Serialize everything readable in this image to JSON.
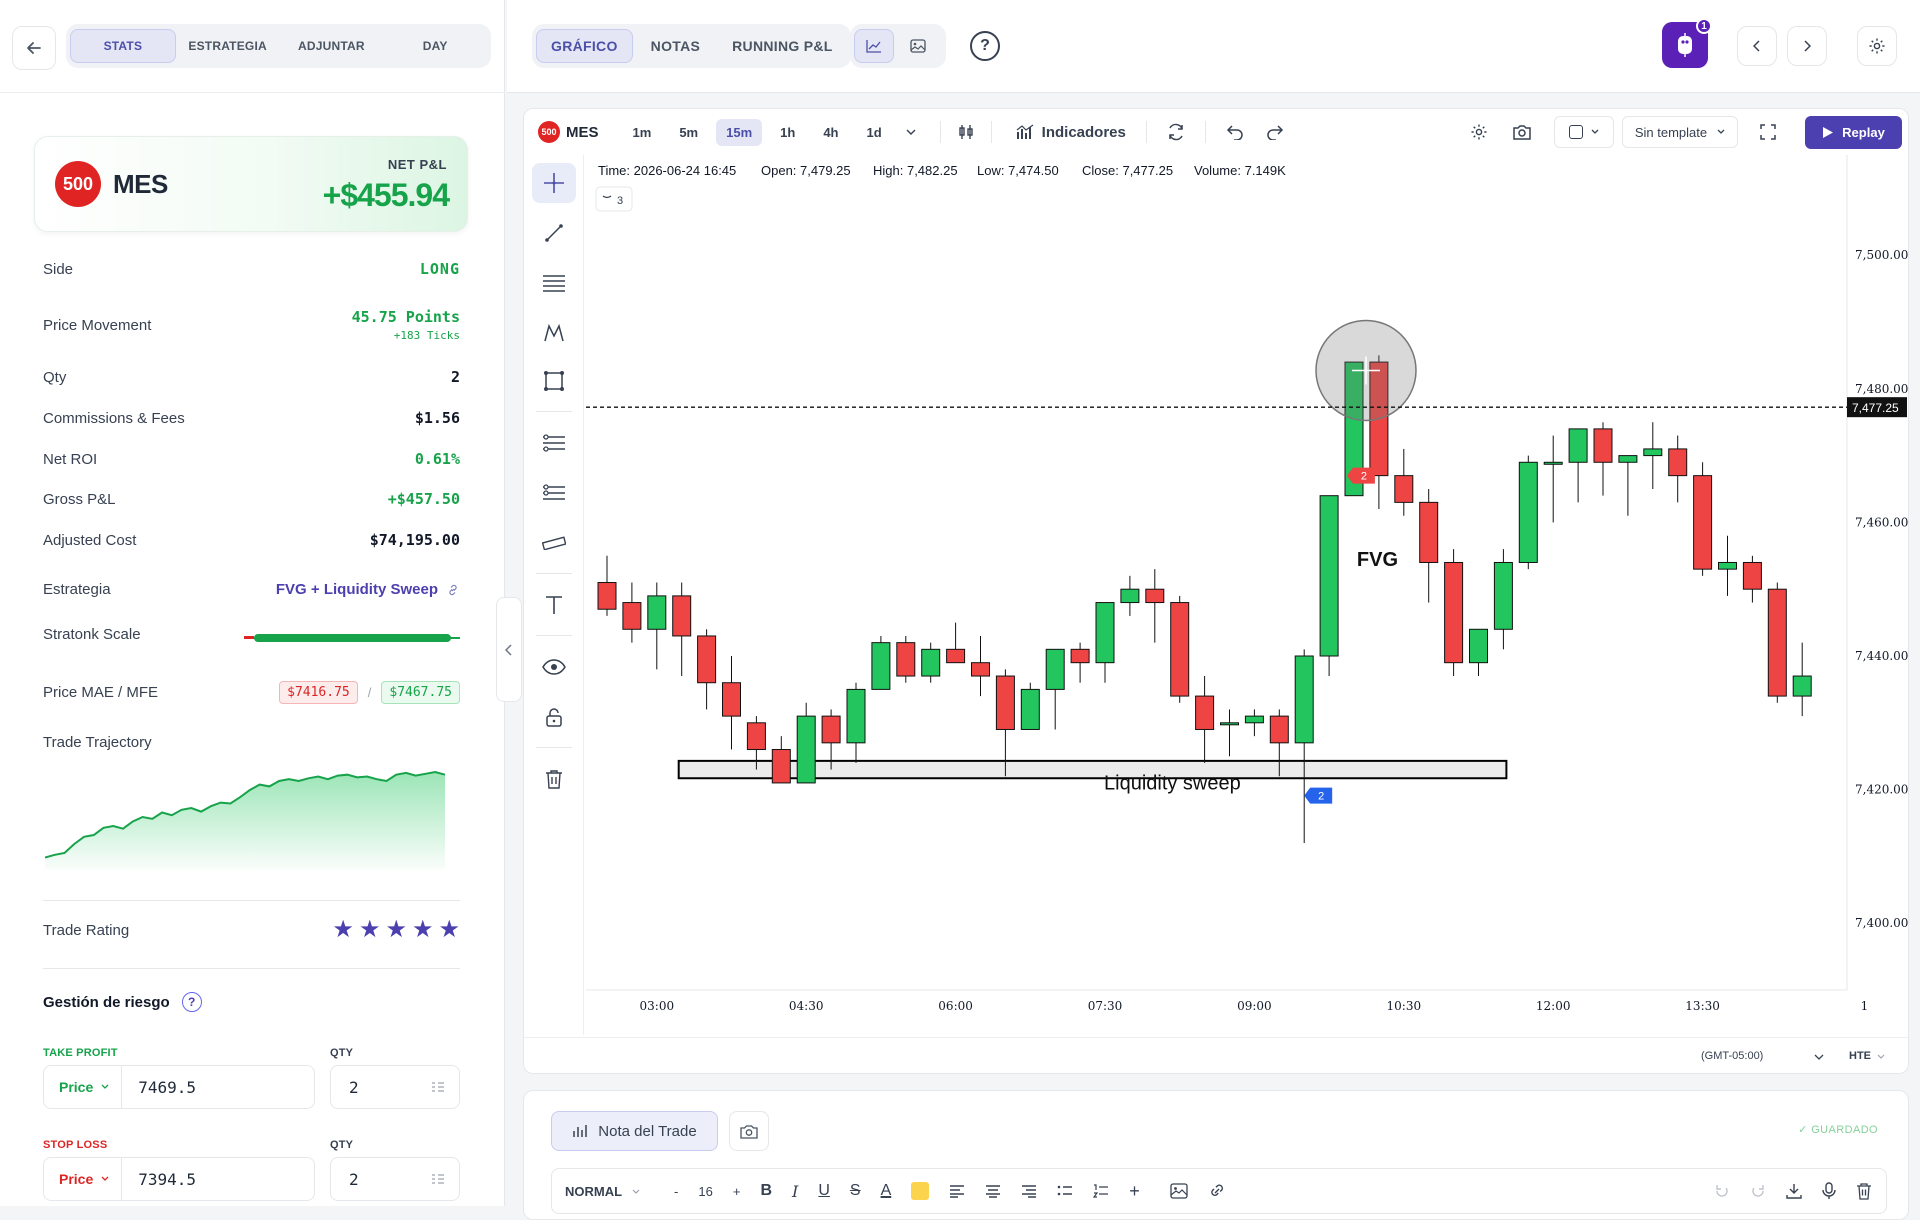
{
  "left": {
    "tabs": [
      "STATS",
      "ESTRATEGIA",
      "ADJUNTAR",
      "DAY"
    ],
    "card": {
      "badge": "500",
      "symbol": "MES",
      "pnl_label": "NET P&L",
      "pnl_value": "+$455.94"
    },
    "rows": {
      "side": {
        "label": "Side",
        "value": "LONG"
      },
      "movement": {
        "label": "Price Movement",
        "value": "45.75 Points",
        "sub": "+183 Ticks"
      },
      "qty": {
        "label": "Qty",
        "value": "2"
      },
      "fees": {
        "label": "Commissions & Fees",
        "value": "$1.56"
      },
      "roi": {
        "label": "Net ROI",
        "value": "0.61%"
      },
      "gross": {
        "label": "Gross P&L",
        "value": "+$457.50"
      },
      "cost": {
        "label": "Adjusted Cost",
        "value": "$74,195.00"
      },
      "strategy": {
        "label": "Estrategia",
        "value": "FVG + Liquidity Sweep"
      },
      "scale": {
        "label": "Stratonk Scale",
        "level": 0.92
      },
      "mae": {
        "label": "Price MAE / MFE",
        "mae": "$7416.75",
        "sep": "/",
        "mfe": "$7467.75"
      },
      "trajectory": {
        "label": "Trade Trajectory"
      },
      "rating": {
        "label": "Trade Rating",
        "stars": 5
      }
    },
    "risk": {
      "title": "Gestión de riesgo",
      "help": "?",
      "tp_label": "TAKE PROFIT",
      "sl_label": "STOP LOSS",
      "qty_label": "QTY",
      "tp_mode": "Price",
      "tp_value": "7469.5",
      "tp_qty": "2",
      "sl_mode": "Price",
      "sl_value": "7394.5",
      "sl_qty": "2"
    },
    "trajectory_values": [
      0.05,
      0.08,
      0.1,
      0.2,
      0.28,
      0.3,
      0.38,
      0.4,
      0.37,
      0.45,
      0.5,
      0.48,
      0.55,
      0.52,
      0.58,
      0.6,
      0.56,
      0.62,
      0.66,
      0.65,
      0.72,
      0.8,
      0.86,
      0.84,
      0.9,
      0.92,
      0.9,
      0.93,
      0.95,
      0.92,
      0.96,
      0.97,
      0.94,
      0.95,
      0.92,
      0.9,
      0.97,
      0.99,
      0.96,
      0.98,
      1.0,
      0.97
    ]
  },
  "top": {
    "tabs": [
      "GRÁFICO",
      "NOTAS",
      "RUNNING P&L"
    ],
    "help": "?",
    "notif_count": "1"
  },
  "chart": {
    "badge": "500",
    "symbol": "MES",
    "timeframes": [
      "1m",
      "5m",
      "15m",
      "1h",
      "4h",
      "1d"
    ],
    "active_tf": "15m",
    "indicators": "Indicadores",
    "template": "Sin template",
    "replay": "Replay",
    "ohlc": {
      "time": "Time: 2026-06-24 16:45",
      "open": "Open: 7,479.25",
      "high": "High: 7,482.25",
      "low": "Low: 7,474.50",
      "close": "Close: 7,477.25",
      "volume": "Volume: 7.149K"
    },
    "collapse_count": "3",
    "timezone": "(GMT-05:00)",
    "session": "HTE",
    "fvg_label": "FVG",
    "sweep_label": "Liquidity sweep",
    "marker_count": "2"
  },
  "chart_data": {
    "type": "candlestick",
    "y_ticks": [
      "7,500.00",
      "7,480.00",
      "7,460.00",
      "7,440.00",
      "7,420.00",
      "7,400.00"
    ],
    "x_ticks": [
      "03:00",
      "04:30",
      "06:00",
      "07:30",
      "09:00",
      "10:30",
      "12:00",
      "13:30",
      "1"
    ],
    "last_price": "7,477.25",
    "ylim": [
      7390,
      7515
    ],
    "candles": [
      {
        "o": 7451,
        "h": 7455,
        "l": 7446,
        "c": 7447
      },
      {
        "o": 7448,
        "h": 7451,
        "l": 7442,
        "c": 7444
      },
      {
        "o": 7444,
        "h": 7451,
        "l": 7438,
        "c": 7449
      },
      {
        "o": 7449,
        "h": 7451,
        "l": 7437,
        "c": 7443
      },
      {
        "o": 7443,
        "h": 7444,
        "l": 7432,
        "c": 7436
      },
      {
        "o": 7436,
        "h": 7440,
        "l": 7426,
        "c": 7431
      },
      {
        "o": 7430,
        "h": 7431,
        "l": 7423,
        "c": 7426
      },
      {
        "o": 7426,
        "h": 7428,
        "l": 7422,
        "c": 7421
      },
      {
        "o": 7421,
        "h": 7433,
        "l": 7421,
        "c": 7431
      },
      {
        "o": 7431,
        "h": 7432,
        "l": 7423,
        "c": 7427
      },
      {
        "o": 7427,
        "h": 7436,
        "l": 7424,
        "c": 7435
      },
      {
        "o": 7435,
        "h": 7443,
        "l": 7435,
        "c": 7442
      },
      {
        "o": 7442,
        "h": 7443,
        "l": 7436,
        "c": 7437
      },
      {
        "o": 7437,
        "h": 7442,
        "l": 7436,
        "c": 7441
      },
      {
        "o": 7441,
        "h": 7445,
        "l": 7439,
        "c": 7439
      },
      {
        "o": 7439,
        "h": 7443,
        "l": 7434,
        "c": 7437
      },
      {
        "o": 7437,
        "h": 7438,
        "l": 7422,
        "c": 7429
      },
      {
        "o": 7429,
        "h": 7436,
        "l": 7429,
        "c": 7435
      },
      {
        "o": 7435,
        "h": 7441,
        "l": 7429,
        "c": 7441
      },
      {
        "o": 7441,
        "h": 7442,
        "l": 7436,
        "c": 7439
      },
      {
        "o": 7439,
        "h": 7446,
        "l": 7436,
        "c": 7448
      },
      {
        "o": 7448,
        "h": 7452,
        "l": 7446,
        "c": 7450
      },
      {
        "o": 7450,
        "h": 7453,
        "l": 7442,
        "c": 7448
      },
      {
        "o": 7448,
        "h": 7449,
        "l": 7433,
        "c": 7434
      },
      {
        "o": 7434,
        "h": 7437,
        "l": 7424,
        "c": 7429
      },
      {
        "o": 7430,
        "h": 7432,
        "l": 7425,
        "c": 7430
      },
      {
        "o": 7430,
        "h": 7432,
        "l": 7428,
        "c": 7431
      },
      {
        "o": 7431,
        "h": 7432,
        "l": 7422,
        "c": 7427
      },
      {
        "o": 7427,
        "h": 7441,
        "l": 7412,
        "c": 7440
      },
      {
        "o": 7440,
        "h": 7464,
        "l": 7437,
        "c": 7464
      },
      {
        "o": 7464,
        "h": 7482,
        "l": 7464,
        "c": 7484
      },
      {
        "o": 7484,
        "h": 7485,
        "l": 7462,
        "c": 7467
      },
      {
        "o": 7467,
        "h": 7471,
        "l": 7461,
        "c": 7463
      },
      {
        "o": 7463,
        "h": 7465,
        "l": 7448,
        "c": 7454
      },
      {
        "o": 7454,
        "h": 7456,
        "l": 7437,
        "c": 7439
      },
      {
        "o": 7439,
        "h": 7444,
        "l": 7437,
        "c": 7444
      },
      {
        "o": 7444,
        "h": 7456,
        "l": 7441,
        "c": 7454
      },
      {
        "o": 7454,
        "h": 7470,
        "l": 7453,
        "c": 7469
      },
      {
        "o": 7469,
        "h": 7473,
        "l": 7460,
        "c": 7469
      },
      {
        "o": 7469,
        "h": 7474,
        "l": 7463,
        "c": 7474
      },
      {
        "o": 7474,
        "h": 7475,
        "l": 7464,
        "c": 7469
      },
      {
        "o": 7469,
        "h": 7470,
        "l": 7461,
        "c": 7470
      },
      {
        "o": 7470,
        "h": 7475,
        "l": 7465,
        "c": 7471
      },
      {
        "o": 7471,
        "h": 7473,
        "l": 7463,
        "c": 7467
      },
      {
        "o": 7467,
        "h": 7469,
        "l": 7452,
        "c": 7453
      },
      {
        "o": 7453,
        "h": 7458,
        "l": 7449,
        "c": 7454
      },
      {
        "o": 7454,
        "h": 7455,
        "l": 7448,
        "c": 7450
      },
      {
        "o": 7450,
        "h": 7451,
        "l": 7433,
        "c": 7434
      },
      {
        "o": 7434,
        "h": 7442,
        "l": 7431,
        "c": 7437
      }
    ],
    "sweep_zone": {
      "from_index": 3,
      "to_index": 36,
      "top": 7424.3,
      "bottom": 7421.7
    },
    "fvg_marker_price": 7467,
    "sweep_marker_price": 7420.3,
    "highlight_index": 30
  }
}
